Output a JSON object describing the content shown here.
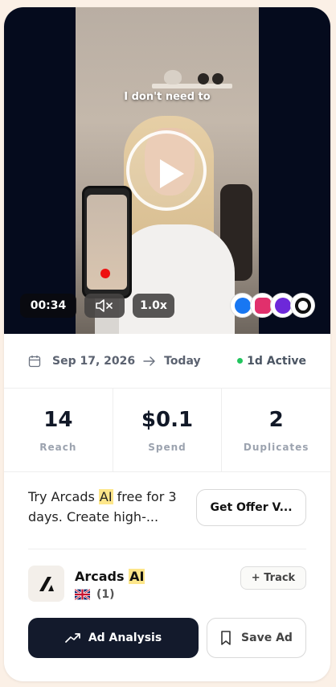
{
  "video": {
    "caption": "I don't need to",
    "duration": "00:34",
    "speed": "1.0x",
    "mute_icon": "muted-speaker-icon",
    "play_icon": "play-icon"
  },
  "platforms": [
    {
      "name": "facebook-icon",
      "color": "#1877f2"
    },
    {
      "name": "instagram-icon",
      "color": "#e1306c"
    },
    {
      "name": "messenger-icon",
      "color": "#6d28d9"
    },
    {
      "name": "audience-network-icon",
      "color": "#111111"
    }
  ],
  "dates": {
    "start": "Sep 17, 2026",
    "end": "Today",
    "status": "1d Active",
    "status_color": "#22c55e"
  },
  "stats": [
    {
      "value": "14",
      "label": "Reach"
    },
    {
      "value": "$0.1",
      "label": "Spend"
    },
    {
      "value": "2",
      "label": "Duplicates"
    }
  ],
  "offer": {
    "text_before": "Try Arcads ",
    "highlight": "AI",
    "text_after": " free for 3 days. Create high-...",
    "button_label": "Get Offer V..."
  },
  "advertiser": {
    "name": "Arcads ",
    "name_highlight": "AI",
    "count": "(1)",
    "flag_icon": "uk-flag-icon",
    "track_label": "+ Track"
  },
  "actions": {
    "analysis_label": "Ad Analysis",
    "save_label": "Save Ad"
  }
}
